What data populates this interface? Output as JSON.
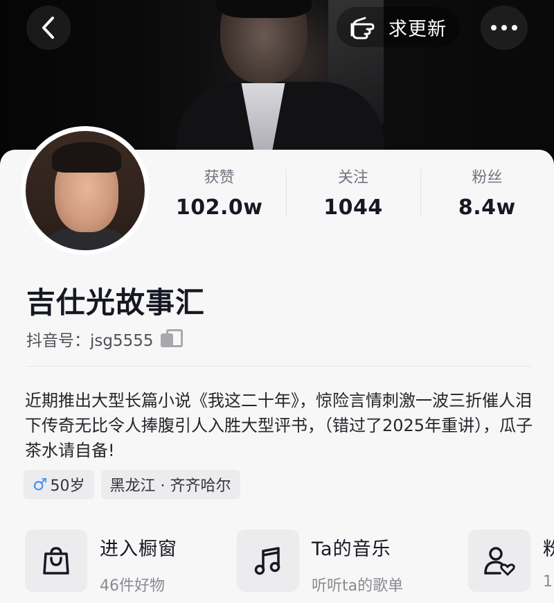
{
  "header": {
    "back_icon": "chevron-left-icon",
    "update_icon": "pointing-hand-icon",
    "update_label": "求更新",
    "more_icon": "more-dots-icon"
  },
  "profile": {
    "stats": [
      {
        "label": "获赞",
        "value": "102.0w"
      },
      {
        "label": "关注",
        "value": "1044"
      },
      {
        "label": "粉丝",
        "value": "8.4w"
      }
    ],
    "nickname": "吉仕光故事汇",
    "douyin_id_label": "抖音号：jsg5555",
    "bio": "近期推出大型长篇小说《我这二十年》，惊险言情刺激一波三折催人泪下传奇无比令人捧腹引人入胜大型评书，（错过了2025年重讲），瓜子茶水请自备!",
    "tags": {
      "gender_symbol": "♂",
      "age": "50岁",
      "location": "黑龙江 · 齐齐哈尔"
    }
  },
  "features": [
    {
      "icon": "shopping-bag-icon",
      "title": "进入橱窗",
      "subtitle": "46件好物"
    },
    {
      "icon": "music-note-icon",
      "title": "Ta的音乐",
      "subtitle": "听听ta的歌单"
    },
    {
      "icon": "fans-group-icon",
      "title": "粉",
      "subtitle": "1"
    }
  ],
  "colors": {
    "text_primary": "#161823",
    "text_secondary": "#737380",
    "gender_blue": "#3e8ef7",
    "background": "#f7f7f7"
  }
}
